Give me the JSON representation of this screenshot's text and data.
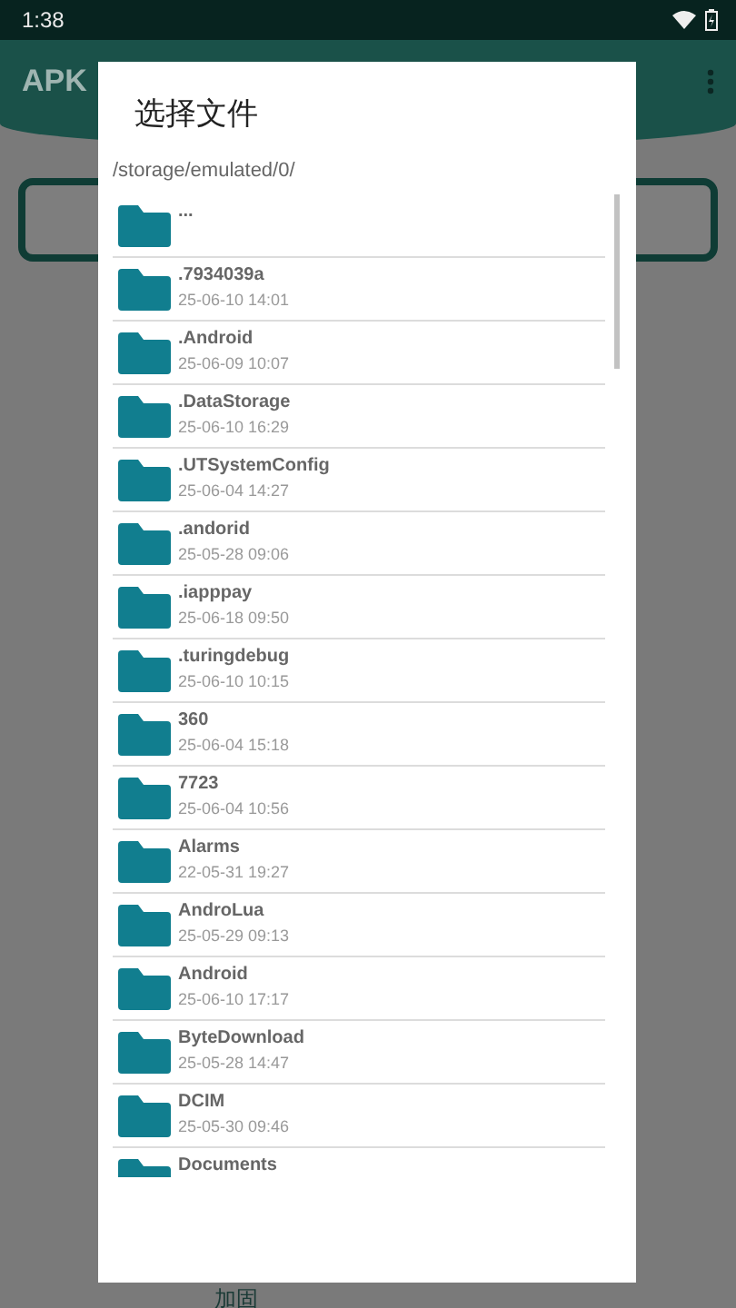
{
  "status_bar": {
    "time": "1:38"
  },
  "app_bar": {
    "title": "APK"
  },
  "bottom_label": "加固",
  "dialog": {
    "title": "选择文件",
    "path": "/storage/emulated/0/",
    "items": [
      {
        "name": "..."
      },
      {
        "name": ".7934039a",
        "date": "25-06-10 14:01"
      },
      {
        "name": ".Android",
        "date": "25-06-09 10:07"
      },
      {
        "name": ".DataStorage",
        "date": "25-06-10 16:29"
      },
      {
        "name": ".UTSystemConfig",
        "date": "25-06-04 14:27"
      },
      {
        "name": ".andorid",
        "date": "25-05-28 09:06"
      },
      {
        "name": ".iapppay",
        "date": "25-06-18 09:50"
      },
      {
        "name": ".turingdebug",
        "date": "25-06-10 10:15"
      },
      {
        "name": "360",
        "date": "25-06-04 15:18"
      },
      {
        "name": "7723",
        "date": "25-06-04 10:56"
      },
      {
        "name": "Alarms",
        "date": "22-05-31 19:27"
      },
      {
        "name": "AndroLua",
        "date": "25-05-29 09:13"
      },
      {
        "name": "Android",
        "date": "25-06-10 17:17"
      },
      {
        "name": "ByteDownload",
        "date": "25-05-28 14:47"
      },
      {
        "name": "DCIM",
        "date": "25-05-30 09:46"
      },
      {
        "name": "Documents"
      }
    ]
  }
}
